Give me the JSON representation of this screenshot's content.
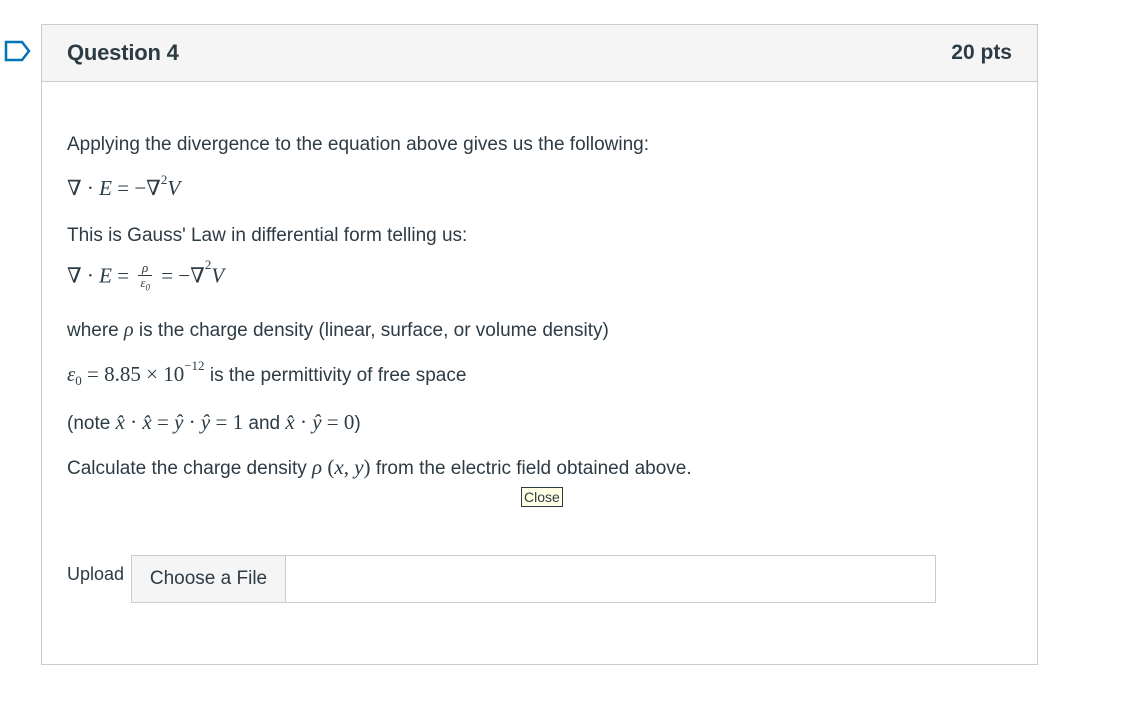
{
  "question": {
    "title": "Question 4",
    "points": "20 pts"
  },
  "body": {
    "intro": "Applying the divergence to the equation above gives us the following:",
    "gauss_text": "This is Gauss' Law in differential form telling us:",
    "where_prefix": "where ",
    "where_suffix": " is the charge density (linear, surface, or volume density)",
    "epsilon_value": "8.85 × 10",
    "epsilon_exp": "−12",
    "epsilon_suffix": " is the permittivity of free space",
    "note_prefix": "(note ",
    "note_middle": " and ",
    "note_suffix": ")",
    "task_prefix": "Calculate the charge density ",
    "task_suffix": " from the electric field obtained above."
  },
  "close_button": "Close",
  "upload": {
    "label": "Upload",
    "button": "Choose a File"
  },
  "colors": {
    "text": "#2d3b45",
    "header_bg": "#f5f5f5",
    "border": "#c7cdd1",
    "bookmark": "#0374b5"
  },
  "icons": {
    "bookmark": "bookmark-outline-icon"
  }
}
